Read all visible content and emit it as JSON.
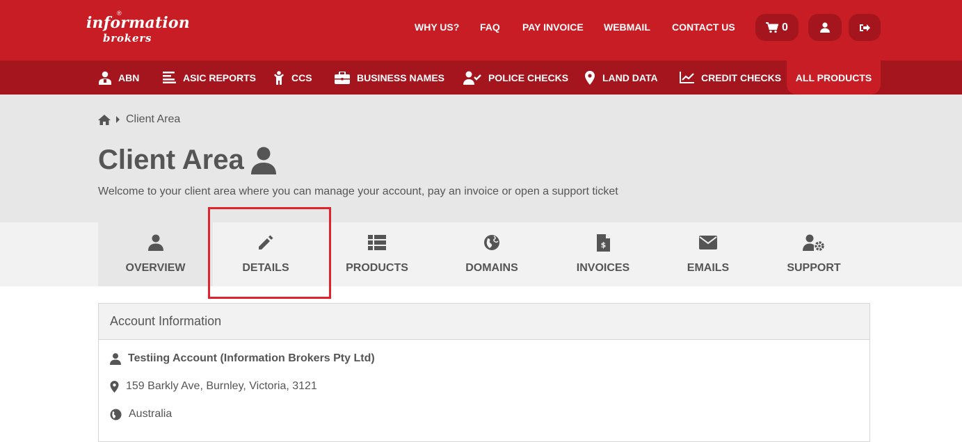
{
  "brand": {
    "line1": "information",
    "line2": "brokers",
    "reg": "®"
  },
  "topnav": {
    "why_us": "WHY US?",
    "faq": "FAQ",
    "pay_invoice": "PAY INVOICE",
    "webmail": "WEBMAIL",
    "contact_us": "CONTACT US",
    "cart_count": "0"
  },
  "subnav": {
    "abn": "ABN",
    "asic": "ASIC REPORTS",
    "ccs": "CCS",
    "business_names": "BUSINESS NAMES",
    "police_checks": "POLICE CHECKS",
    "land_data": "LAND DATA",
    "credit_checks": "CREDIT CHECKS",
    "all_products": "ALL PRODUCTS"
  },
  "breadcrumb": {
    "current": "Client Area"
  },
  "page": {
    "title": "Client Area",
    "subtitle": "Welcome to your client area where you can manage your account, pay an invoice or open a support ticket"
  },
  "tabs": {
    "overview": "OVERVIEW",
    "details": "DETAILS",
    "products": "PRODUCTS",
    "domains": "DOMAINS",
    "invoices": "INVOICES",
    "emails": "EMAILS",
    "support": "SUPPORT"
  },
  "account": {
    "heading": "Account Information",
    "name": "Testiing Account (Information Brokers Pty Ltd)",
    "address": "159 Barkly Ave, Burnley, Victoria, 3121",
    "country": "Australia"
  },
  "colors": {
    "primary_red": "#c81d25",
    "dark_red": "#a5151d",
    "highlight": "#e0222a"
  }
}
